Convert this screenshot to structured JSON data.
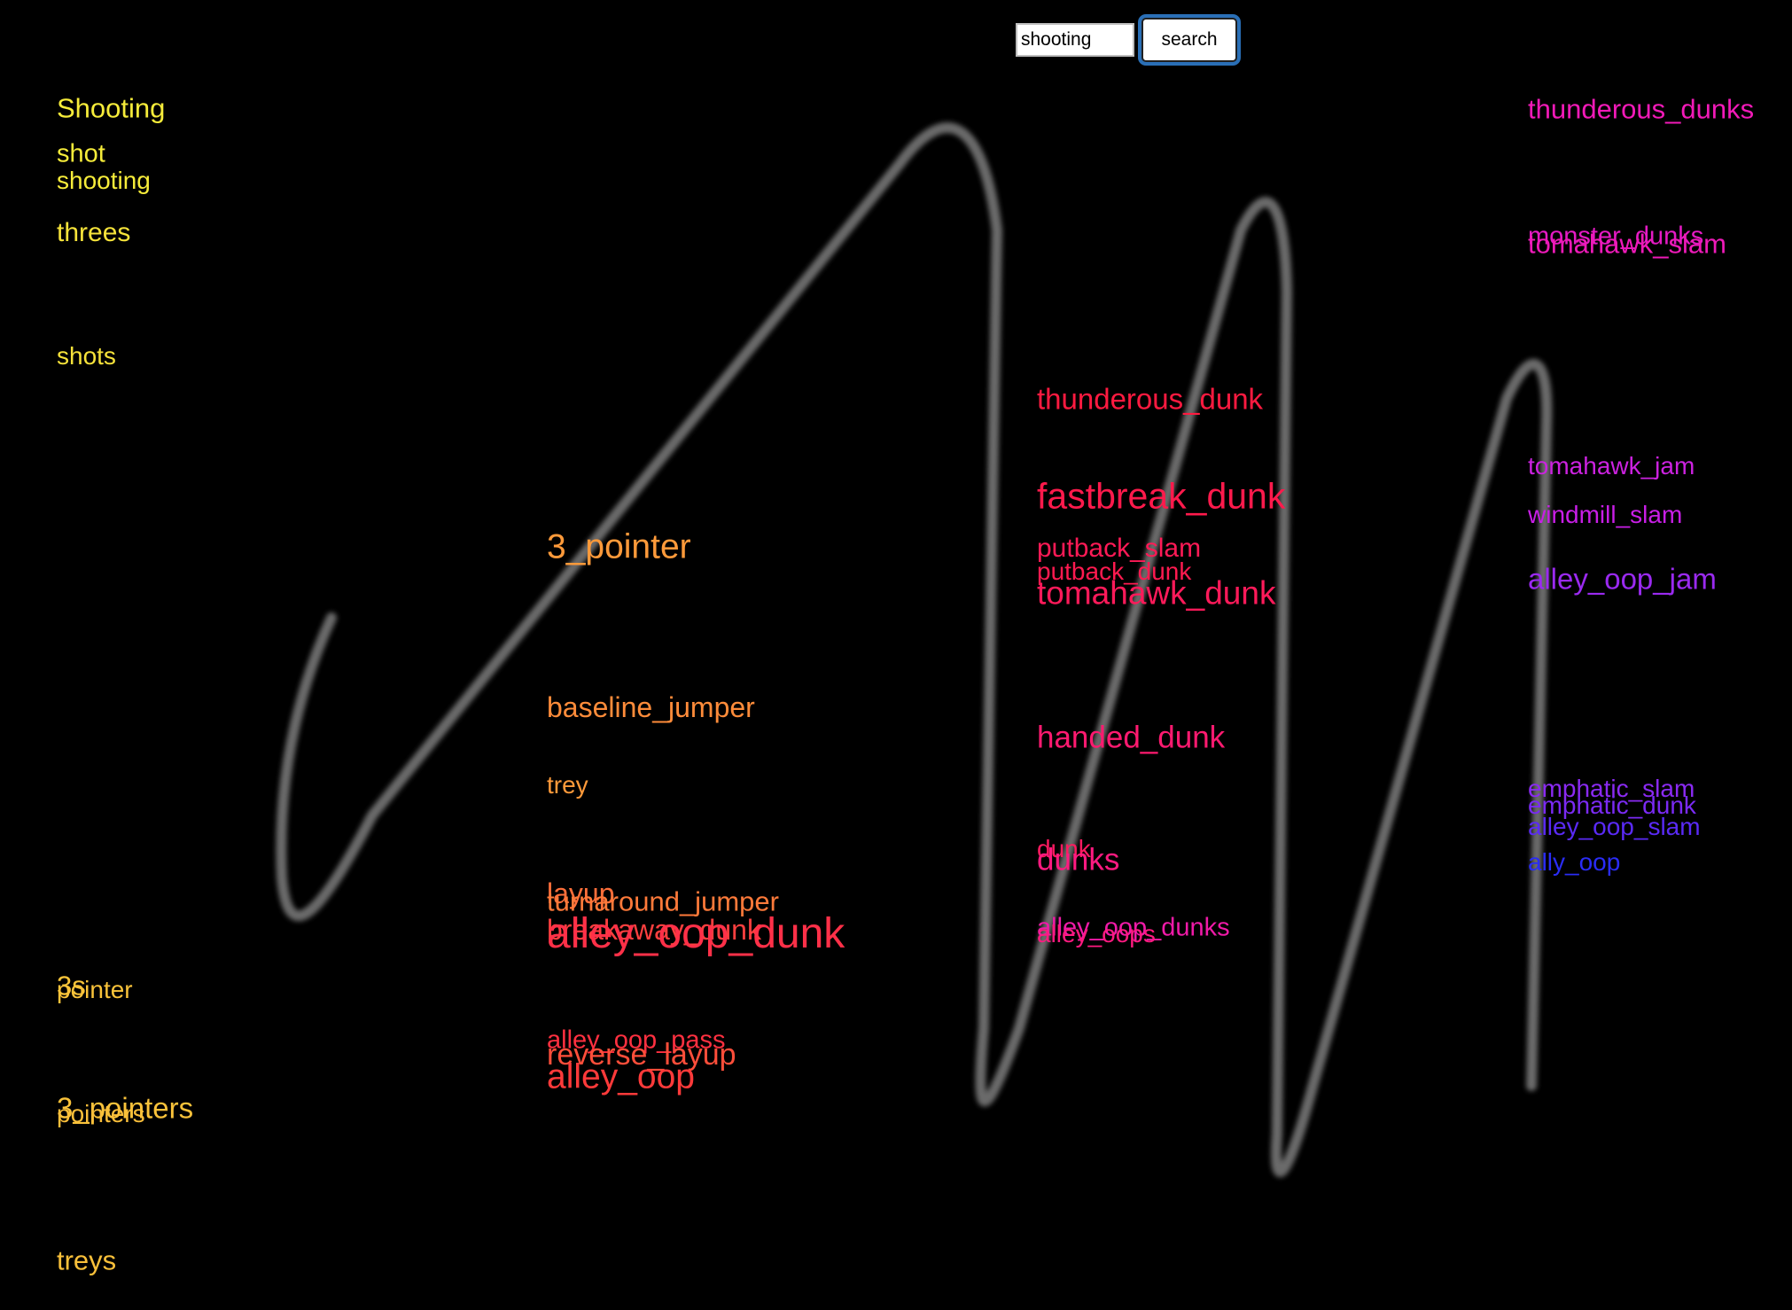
{
  "search": {
    "value": "shooting",
    "button_label": "search"
  },
  "colors": {
    "background": "#000000",
    "path": "#6a6a6a"
  },
  "columns": [
    {
      "items": [
        {
          "text": "Shooting",
          "color": "#f6ec3a"
        },
        {
          "text": "shot",
          "color": "#f6ec3a"
        },
        {
          "text": "shooting",
          "color": "#f6ec3a"
        },
        {
          "text": "threes",
          "color": "#f6e33a"
        },
        {
          "text": "shots",
          "color": "#f6e23a"
        },
        {
          "text": "3s",
          "color": "#f9c53a"
        },
        {
          "text": "pointer",
          "color": "#f9c33a"
        },
        {
          "text": "3_pointers",
          "color": "#f9c23a"
        },
        {
          "text": "pointers",
          "color": "#f9be3a"
        },
        {
          "text": "treys",
          "color": "#f9c03a"
        }
      ]
    },
    {
      "items": [
        {
          "text": "3_pointer",
          "color": "#ff9a3a"
        },
        {
          "text": "baseline_jumper",
          "color": "#ff8c3a"
        },
        {
          "text": "trey",
          "color": "#ff9a3a"
        },
        {
          "text": "layup",
          "color": "#ff6f3a"
        },
        {
          "text": "turnaround_jumper",
          "color": "#ff7a3a"
        },
        {
          "text": "breakaway_dunk",
          "color": "#ff3f3f"
        },
        {
          "text": "alley_oop_dunk",
          "color": "#ff3048"
        },
        {
          "text": "alley_oop_pass",
          "color": "#ff3040"
        },
        {
          "text": "reverse_layup",
          "color": "#ff4e3a"
        },
        {
          "text": "alley_oop",
          "color": "#ff3a3a"
        }
      ]
    },
    {
      "items": [
        {
          "text": "thunderous_dunk",
          "color": "#ff1a40"
        },
        {
          "text": "fastbreak_dunk",
          "color": "#ff1a4c"
        },
        {
          "text": "putback_slam",
          "color": "#ff1a56"
        },
        {
          "text": "putback_dunk",
          "color": "#ff1a50"
        },
        {
          "text": "tomahawk_dunk",
          "color": "#ff1a5a"
        },
        {
          "text": "handed_dunk",
          "color": "#ff1a70"
        },
        {
          "text": "dunk",
          "color": "#ff1a60"
        },
        {
          "text": "dunks",
          "color": "#ff1a80"
        },
        {
          "text": "alley_oop_dunks",
          "color": "#f01aa8"
        },
        {
          "text": "alley_oops",
          "color": "#ff1a80"
        }
      ]
    },
    {
      "items": [
        {
          "text": "thunderous_dunks",
          "color": "#f21ab8"
        },
        {
          "text": "monster_dunks",
          "color": "#e51ac4"
        },
        {
          "text": "tomahawk_slam",
          "color": "#ee1ab8"
        },
        {
          "text": "tomahawk_jam",
          "color": "#cc22e0"
        },
        {
          "text": "windmill_slam",
          "color": "#c81ee6"
        },
        {
          "text": "alley_oop_jam",
          "color": "#9a2af0"
        },
        {
          "text": "emphatic_slam",
          "color": "#8a2af2"
        },
        {
          "text": "emphatic_dunk",
          "color": "#7a2af4"
        },
        {
          "text": "alley_oop_slam",
          "color": "#5a2af6"
        },
        {
          "text": "ally_oop",
          "color": "#2a2cf6"
        }
      ]
    }
  ]
}
